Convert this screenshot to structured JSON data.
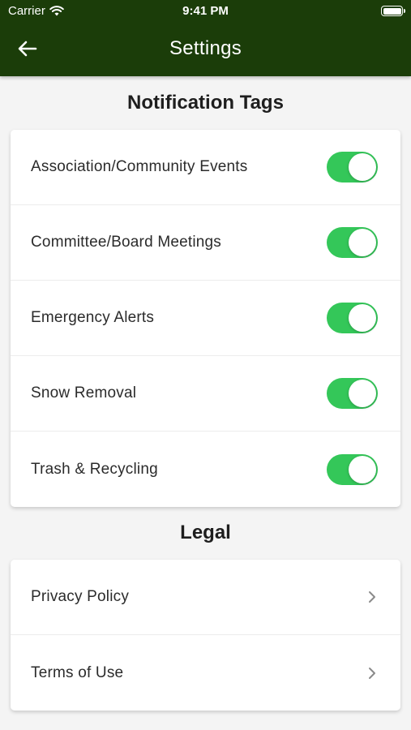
{
  "status_bar": {
    "carrier": "Carrier",
    "time": "9:41 PM"
  },
  "header": {
    "title": "Settings"
  },
  "notification_section": {
    "title": "Notification Tags",
    "items": [
      {
        "label": "Association/Community Events",
        "enabled": true
      },
      {
        "label": "Committee/Board Meetings",
        "enabled": true
      },
      {
        "label": "Emergency Alerts",
        "enabled": true
      },
      {
        "label": "Snow Removal",
        "enabled": true
      },
      {
        "label": "Trash & Recycling",
        "enabled": true
      }
    ]
  },
  "legal_section": {
    "title": "Legal",
    "items": [
      {
        "label": "Privacy Policy"
      },
      {
        "label": "Terms of Use"
      }
    ]
  },
  "colors": {
    "header_bg": "#1b3d09",
    "toggle_on": "#34c759",
    "page_bg": "#f4f4f4"
  }
}
